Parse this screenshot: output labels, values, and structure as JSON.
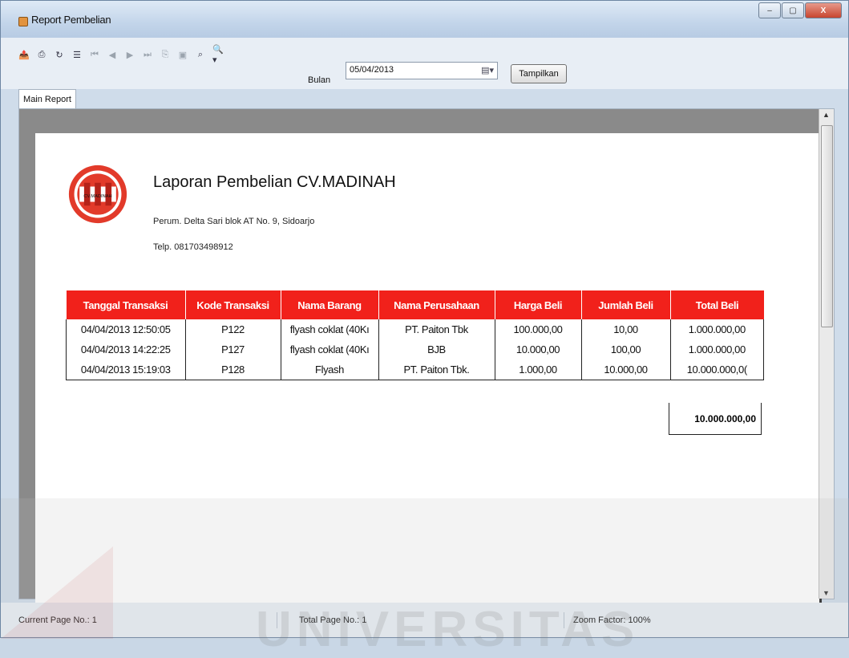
{
  "window": {
    "title": "Report Pembelian",
    "minimize": "–",
    "maximize": "▢",
    "close": "X"
  },
  "toolbar": {
    "icons": [
      "export-icon",
      "print-icon",
      "refresh-icon",
      "tree-toggle-icon",
      "first-page-icon",
      "prev-page-icon",
      "next-page-icon",
      "last-page-icon",
      "goto-page-icon",
      "stop-icon",
      "search-icon",
      "zoom-icon"
    ],
    "bulan_label": "Bulan",
    "date_value": "05/04/2013",
    "tampilkan_label": "Tampilkan"
  },
  "tab": {
    "label": "Main Report"
  },
  "report": {
    "title": "Laporan Pembelian CV.MADINAH",
    "address": "Perum. Delta Sari blok AT No. 9, Sidoarjo",
    "telp": "Telp. 081703498912",
    "logo_text": "CV.MADINAH",
    "columns": [
      "Tanggal Transaksi",
      "Kode Transaksi",
      "Nama Barang",
      "Nama Perusahaan",
      "Harga Beli",
      "Jumlah Beli",
      "Total Beli"
    ],
    "rows": [
      [
        "04/04/2013 12:50:05",
        "P122",
        "flyash coklat (40Kı",
        "PT. Paiton Tbk",
        "100.000,00",
        "10,00",
        "1.000.000,00"
      ],
      [
        "04/04/2013 14:22:25",
        "P127",
        "flyash coklat (40Kı",
        "BJB",
        "10.000,00",
        "100,00",
        "1.000.000,00"
      ],
      [
        "04/04/2013 15:19:03",
        "P128",
        "Flyash",
        "PT. Paiton Tbk.",
        "1.000,00",
        "10.000,00",
        "10.000.000,0("
      ]
    ],
    "grand_total": "10.000.000,00"
  },
  "status": {
    "current_page": "Current Page No.: 1",
    "total_page": "Total Page No.: 1",
    "zoom": "Zoom Factor: 100%"
  },
  "watermark": {
    "text": "UNIVERSITAS"
  },
  "colors": {
    "header_red": "#f1211b",
    "logo_red": "#e23a2a"
  }
}
